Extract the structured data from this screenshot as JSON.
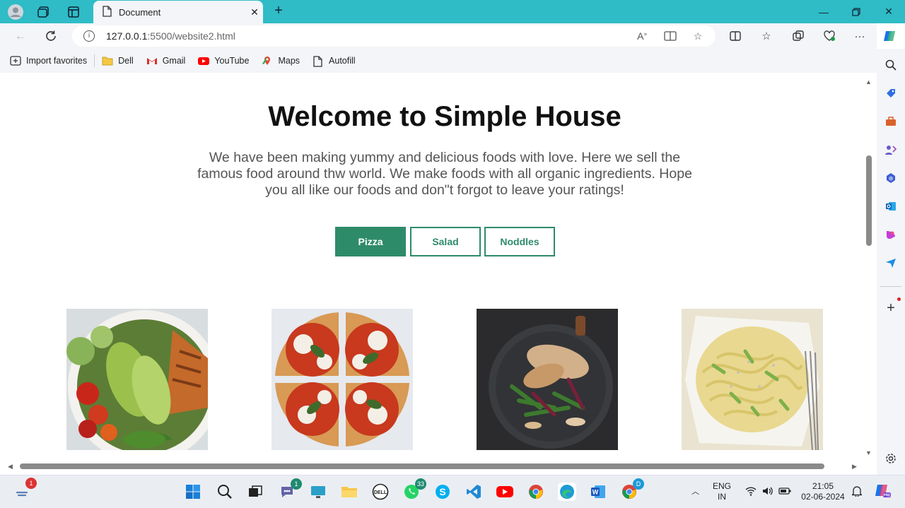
{
  "browser": {
    "tab_title": "Document",
    "url_host": "127.0.0.1",
    "url_path": ":5500/website2.html",
    "bookmarks": [
      "Import favorites",
      "Dell",
      "Gmail",
      "YouTube",
      "Maps",
      "Autofill"
    ]
  },
  "page": {
    "title": "Welcome to Simple House",
    "description": "We have been making yummy and delicious foods with love. Here we sell the famous food around thw world. We make foods with all organic ingredients. Hope you all like our foods and don\"t forgot to leave your ratings!",
    "buttons": [
      "Pizza",
      "Salad",
      "Noddles"
    ],
    "active_button": "Pizza",
    "accent_color": "#2e8b6a"
  },
  "taskbar": {
    "notification_badge": "1",
    "chat_badge": "1",
    "whatsapp_badge": "33",
    "chrome_badge": "D",
    "lang_line1": "ENG",
    "lang_line2": "IN",
    "time": "21:05",
    "date": "02-06-2024"
  }
}
